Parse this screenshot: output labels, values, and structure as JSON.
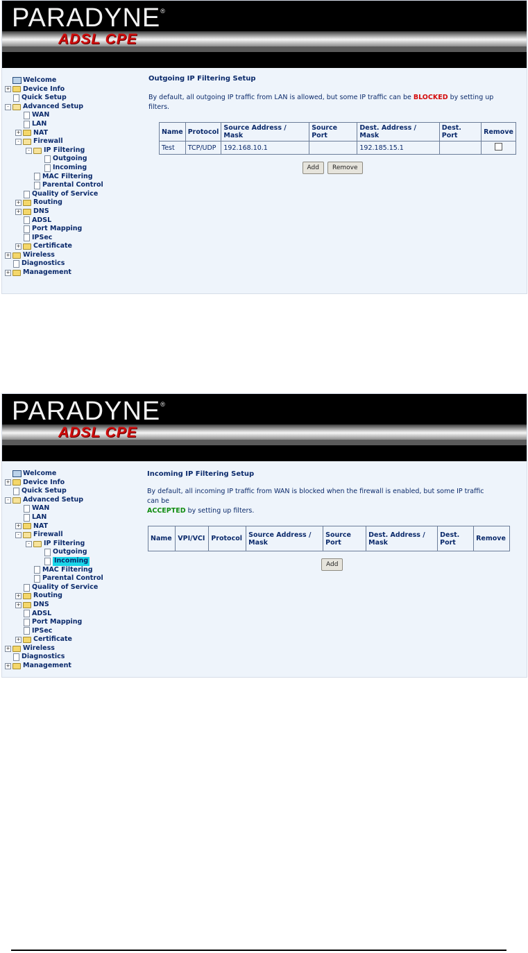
{
  "brand": {
    "logo": "PARADYNE",
    "registered": "®",
    "product": "ADSL CPE"
  },
  "tree": [
    {
      "id": "welcome",
      "label": "Welcome",
      "depth": 0,
      "kind": "computer",
      "toggle": ""
    },
    {
      "id": "device-info",
      "label": "Device Info",
      "depth": 0,
      "kind": "folder",
      "toggle": "+"
    },
    {
      "id": "quick-setup",
      "label": "Quick Setup",
      "depth": 0,
      "kind": "doc",
      "toggle": ""
    },
    {
      "id": "advanced-setup",
      "label": "Advanced Setup",
      "depth": 0,
      "kind": "folder-open",
      "toggle": "-"
    },
    {
      "id": "wan",
      "label": "WAN",
      "depth": 1,
      "kind": "doc",
      "toggle": ""
    },
    {
      "id": "lan",
      "label": "LAN",
      "depth": 1,
      "kind": "doc",
      "toggle": ""
    },
    {
      "id": "nat",
      "label": "NAT",
      "depth": 1,
      "kind": "folder",
      "toggle": "+"
    },
    {
      "id": "firewall",
      "label": "Firewall",
      "depth": 1,
      "kind": "folder-open",
      "toggle": "-"
    },
    {
      "id": "ip-filtering",
      "label": "IP Filtering",
      "depth": 2,
      "kind": "folder-open",
      "toggle": "-"
    },
    {
      "id": "outgoing",
      "label": "Outgoing",
      "depth": 3,
      "kind": "doc",
      "toggle": ""
    },
    {
      "id": "incoming",
      "label": "Incoming",
      "depth": 3,
      "kind": "doc",
      "toggle": ""
    },
    {
      "id": "mac-filtering",
      "label": "MAC Filtering",
      "depth": 2,
      "kind": "doc",
      "toggle": ""
    },
    {
      "id": "parental-control",
      "label": "Parental Control",
      "depth": 2,
      "kind": "doc",
      "toggle": ""
    },
    {
      "id": "qos",
      "label": "Quality of Service",
      "depth": 1,
      "kind": "doc",
      "toggle": ""
    },
    {
      "id": "routing",
      "label": "Routing",
      "depth": 1,
      "kind": "folder",
      "toggle": "+"
    },
    {
      "id": "dns",
      "label": "DNS",
      "depth": 1,
      "kind": "folder",
      "toggle": "+"
    },
    {
      "id": "adsl",
      "label": "ADSL",
      "depth": 1,
      "kind": "doc",
      "toggle": ""
    },
    {
      "id": "port-mapping",
      "label": "Port Mapping",
      "depth": 1,
      "kind": "doc",
      "toggle": ""
    },
    {
      "id": "ipsec",
      "label": "IPSec",
      "depth": 1,
      "kind": "doc",
      "toggle": ""
    },
    {
      "id": "certificate",
      "label": "Certificate",
      "depth": 1,
      "kind": "folder",
      "toggle": "+"
    },
    {
      "id": "wireless",
      "label": "Wireless",
      "depth": 0,
      "kind": "folder",
      "toggle": "+"
    },
    {
      "id": "diagnostics",
      "label": "Diagnostics",
      "depth": 0,
      "kind": "doc",
      "toggle": ""
    },
    {
      "id": "management",
      "label": "Management",
      "depth": 0,
      "kind": "folder",
      "toggle": "+"
    }
  ],
  "outgoing": {
    "title": "Outgoing IP Filtering Setup",
    "desc_pre": "By default, all outgoing IP traffic from LAN is allowed, but some IP traffic can be ",
    "desc_emph": "BLOCKED",
    "desc_post": " by setting up filters.",
    "headers": [
      "Name",
      "Protocol",
      "Source Address / Mask",
      "Source Port",
      "Dest. Address / Mask",
      "Dest. Port",
      "Remove"
    ],
    "rows": [
      [
        "Test",
        "TCP/UDP",
        "192.168.10.1",
        "",
        "192.185.15.1",
        ""
      ]
    ],
    "add_label": "Add",
    "remove_label": "Remove"
  },
  "incoming": {
    "title": "Incoming IP Filtering Setup",
    "desc_pre": "By default, all incoming IP traffic from WAN is blocked when the firewall is enabled, but some IP traffic can be",
    "desc_emph": "ACCEPTED",
    "desc_post": " by setting up filters.",
    "headers": [
      "Name",
      "VPI/VCI",
      "Protocol",
      "Source Address / Mask",
      "Source Port",
      "Dest. Address / Mask",
      "Dest. Port",
      "Remove"
    ],
    "add_label": "Add"
  }
}
